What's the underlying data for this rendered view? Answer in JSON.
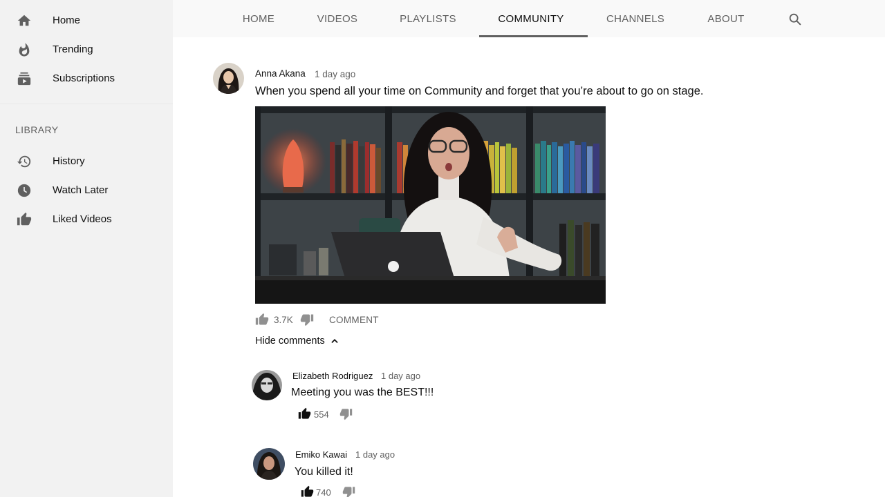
{
  "sidebar": {
    "items": [
      {
        "label": "Home",
        "icon": "home-icon"
      },
      {
        "label": "Trending",
        "icon": "trending-icon"
      },
      {
        "label": "Subscriptions",
        "icon": "subscriptions-icon"
      }
    ],
    "library_heading": "LIBRARY",
    "library_items": [
      {
        "label": "History",
        "icon": "history-icon"
      },
      {
        "label": "Watch Later",
        "icon": "clock-icon"
      },
      {
        "label": "Liked Videos",
        "icon": "thumbs-up-icon"
      }
    ]
  },
  "tabs": {
    "items": [
      {
        "label": "HOME"
      },
      {
        "label": "VIDEOS"
      },
      {
        "label": "PLAYLISTS"
      },
      {
        "label": "COMMUNITY"
      },
      {
        "label": "CHANNELS"
      },
      {
        "label": "ABOUT"
      }
    ],
    "active": "COMMUNITY",
    "search_icon": "search-icon"
  },
  "post": {
    "author": "Anna Akana",
    "time": "1 day ago",
    "text": "When you spend all your time on Community and forget that you’re about to go on stage.",
    "likes": "3.7K",
    "comment_label": "COMMENT",
    "hide_comments_label": "Hide comments"
  },
  "comments": [
    {
      "author": "Elizabeth Rodriguez",
      "time": "1 day ago",
      "text": "Meeting you was the BEST!!!",
      "likes": "554"
    },
    {
      "author": "Emiko Kawai",
      "time": "1 day ago",
      "text": "You killed it!",
      "likes": "740"
    }
  ],
  "colors": {
    "sidebar_bg": "#f2f2f2",
    "icon_gray": "#606060",
    "text_primary": "#0f0f0f",
    "text_secondary": "#606060"
  }
}
